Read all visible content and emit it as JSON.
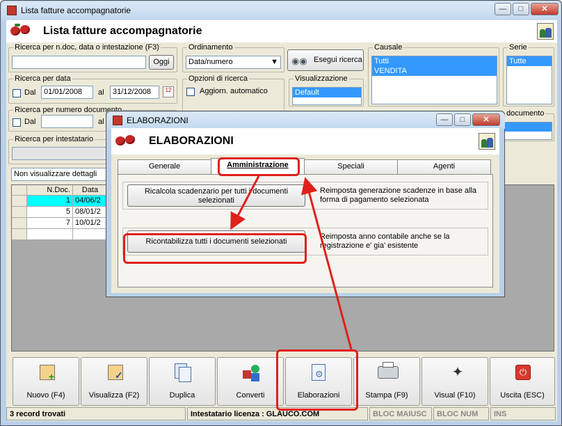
{
  "window": {
    "title": "Lista fatture accompagnatorie",
    "header": "Lista fatture accompagnatorie"
  },
  "search": {
    "legend": "Ricerca per n.doc, data o intestazione (F3)",
    "value": "",
    "oggi": "Oggi"
  },
  "ordinamento": {
    "legend": "Ordinamento",
    "selected": "Data/numero"
  },
  "esegui": {
    "label": "Esegui ricerca"
  },
  "causale": {
    "legend": "Causale",
    "items": [
      "Tutti",
      "VENDITA"
    ]
  },
  "serie": {
    "legend": "Serie",
    "items": [
      "Tutte"
    ]
  },
  "ricerca_data": {
    "legend": "Ricerca per data",
    "dal": "Dal",
    "from": "01/01/2008",
    "al": "al",
    "to": "31/12/2008"
  },
  "opzioni": {
    "legend": "Opzioni di ricerca",
    "aggiorn": "Aggiorn. automatico"
  },
  "visualizzazione": {
    "legend": "Visualizzazione",
    "items": [
      "Default"
    ]
  },
  "ricerca_numero": {
    "legend": "Ricerca per numero documento",
    "dal": "Dal",
    "al": "al"
  },
  "tipo_documento": {
    "legend": "documento"
  },
  "ricerca_intest": {
    "legend": "Ricerca per intestatario"
  },
  "dettagli": {
    "value": "Non visualizzare dettagli"
  },
  "grid": {
    "headers": [
      "N.Doc.",
      "Data"
    ],
    "rows": [
      [
        "1",
        "04/06/2"
      ],
      [
        "5",
        "08/01/2"
      ],
      [
        "7",
        "10/01/2"
      ]
    ]
  },
  "toolbar": {
    "nuovo": "Nuovo (F4)",
    "visualizza": "Visualizza (F2)",
    "duplica": "Duplica",
    "converti": "Converti",
    "elaborazioni": "Elaborazioni",
    "stampa": "Stampa (F9)",
    "visual": "Visual (F10)",
    "uscita": "Uscita (ESC)"
  },
  "statusbar": {
    "records": "3 record trovati",
    "licenza": "Intestatario licenza : GLAUCO.COM",
    "maiusc": "BLOC MAIUSC",
    "num": "BLOC NUM",
    "ins": "INS"
  },
  "dialog": {
    "title": "ELABORAZIONI",
    "header": "ELABORAZIONI",
    "tabs": [
      "Generale",
      "Amministrazione",
      "Speciali",
      "Agenti"
    ],
    "btn1": "Ricalcola scadenzario per tutti i documenti selezionati",
    "desc1": "Reimposta generazione scadenze in base alla forma di pagamento selezionata",
    "btn2": "Ricontabilizza tutti i documenti selezionati",
    "desc2": "Reimposta anno contabile anche se la registrazione e' gia' esistente"
  },
  "colors": {
    "accent": "#3399ff",
    "highlight": "#e0201b",
    "selected_row": "#00ffff"
  }
}
